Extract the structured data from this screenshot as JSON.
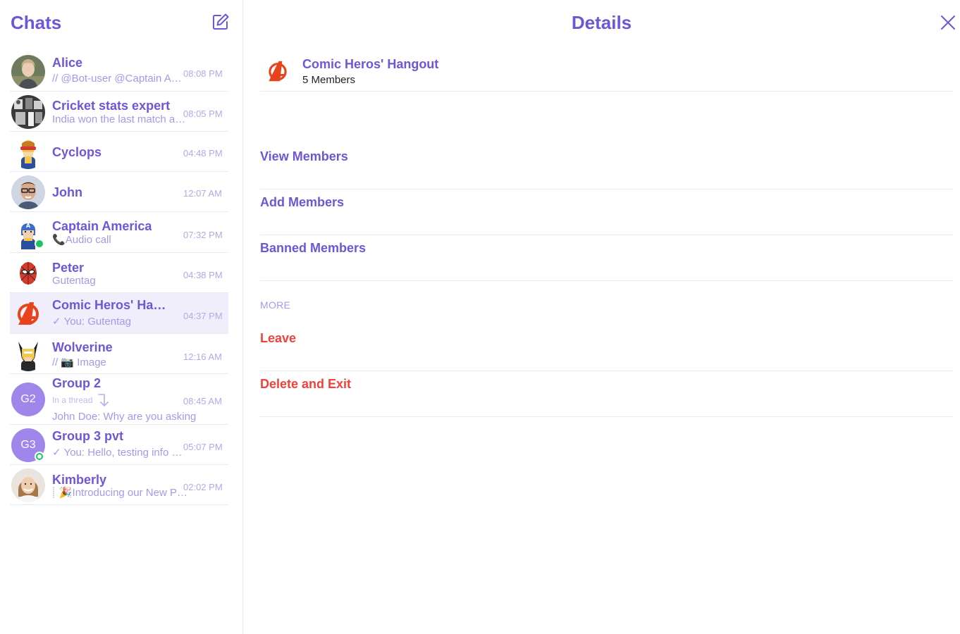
{
  "sidebar": {
    "title": "Chats",
    "compose_icon": "compose-icon",
    "chats": [
      {
        "name": "Alice",
        "receipt": "double-check-icon",
        "preview": "@Bot-user @Captain America",
        "time": "08:08 PM",
        "avatar": "alice-photo"
      },
      {
        "name": "Cricket stats expert",
        "preview": "India won the last match against Pakistan",
        "time": "08:05 PM",
        "avatar": "cricket-photo"
      },
      {
        "name": "Cyclops",
        "time": "04:48 PM",
        "avatar": "cyclops-icon"
      },
      {
        "name": "John",
        "time": "12:07 AM",
        "avatar": "john-photo"
      },
      {
        "name": "Captain America",
        "preview_icon": "📞",
        "preview": "Audio call",
        "time": "07:32 PM",
        "avatar": "captain-america-icon",
        "online": true
      },
      {
        "name": "Peter",
        "preview": "Gutentag",
        "time": "04:38 PM",
        "avatar": "spiderman-icon"
      },
      {
        "name": "Comic Heros' Hangout",
        "receipt": "check-icon",
        "preview": "You: Gutentag",
        "time": "04:37 PM",
        "avatar": "avengers-logo",
        "active": true
      },
      {
        "name": "Wolverine",
        "receipt": "double-check-icon",
        "preview_icon": "📷",
        "preview": "Image",
        "time": "12:16 AM",
        "avatar": "wolverine-icon"
      },
      {
        "name": "Group 2",
        "initials": "G2",
        "thread_label": "In a thread",
        "preview": "John Doe: Why are you asking",
        "time": "08:45 AM"
      },
      {
        "name": "Group 3 pvt",
        "initials": "G3",
        "receipt": "check-icon",
        "preview": "You: Hello, testing info message",
        "time": "05:07 PM",
        "online_ring": true
      },
      {
        "name": "Kimberly",
        "preview_icon": "🎉",
        "preview": "Introducing our New Product",
        "time": "02:02 PM",
        "avatar": "kimberly-photo"
      }
    ]
  },
  "details": {
    "title": "Details",
    "close_icon": "close-icon",
    "group": {
      "name": "Comic Heros' Hangout",
      "members": "5 Members"
    },
    "options": [
      "View Members",
      "Add Members",
      "Banned Members"
    ],
    "more_label": "MORE",
    "danger_options": [
      "Leave",
      "Delete and Exit"
    ]
  },
  "colors": {
    "accent": "#6f55d8",
    "muted": "#a897ec",
    "danger": "#f2413a",
    "online": "#18c663",
    "active_bg": "#f0eefb"
  }
}
